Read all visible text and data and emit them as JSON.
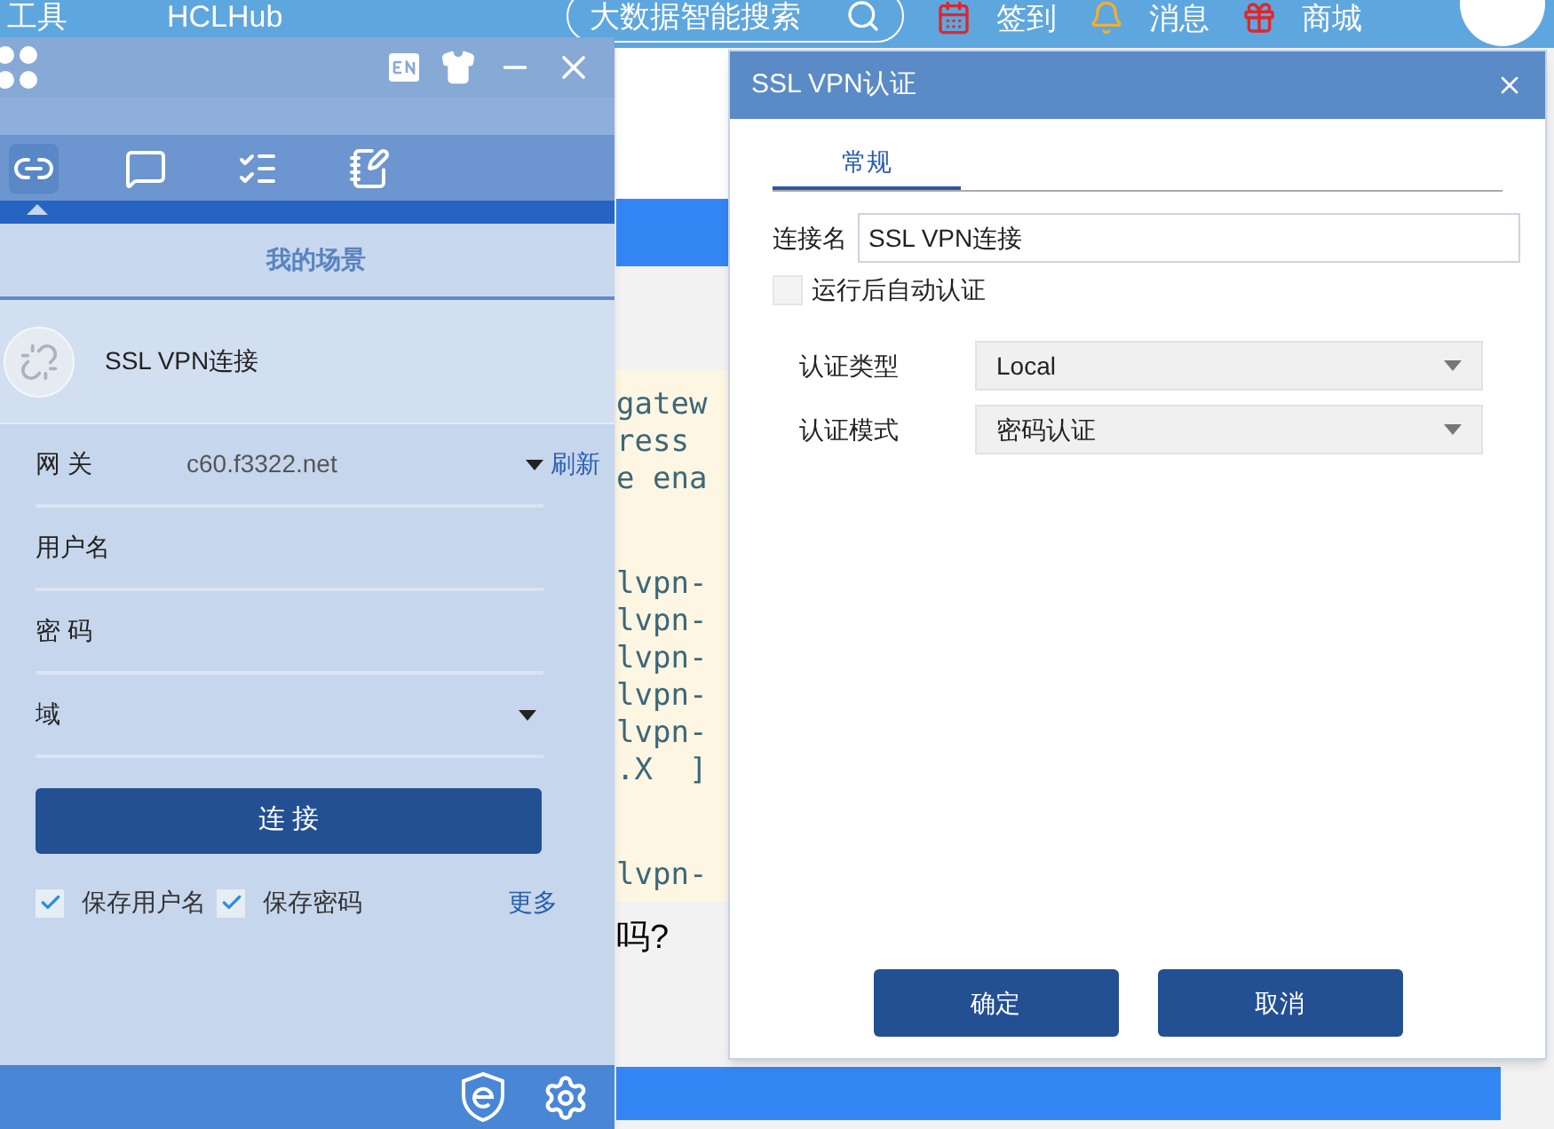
{
  "web_page": {
    "top_bar": {
      "items": [
        "工具",
        "HCLHub"
      ],
      "search_placeholder": "大数据智能搜索",
      "links": [
        {
          "kind": "calendar",
          "label": "签到"
        },
        {
          "kind": "bell",
          "label": "消息"
        },
        {
          "kind": "gift",
          "label": "商城"
        }
      ]
    },
    "code_blocks": [
      [
        "gatew",
        "ress",
        "e ena"
      ],
      [
        "lvpn-",
        "lvpn-",
        "lvpn-",
        "lvpn-",
        "lvpn-",
        ".X  ]"
      ],
      [
        "lvpn-"
      ]
    ],
    "text_fragment": "吗?"
  },
  "inode_client": {
    "tabs": [
      {
        "kind": "link",
        "selected": true
      },
      {
        "kind": "message",
        "selected": false
      },
      {
        "kind": "list",
        "selected": false
      },
      {
        "kind": "notebook",
        "selected": false
      }
    ],
    "section_title": "我的场景",
    "scene": "SSL VPN连接",
    "form": [
      {
        "kind": "select",
        "label": "网 关",
        "value": "c60.f3322.net",
        "action": "刷新"
      },
      {
        "kind": "text",
        "label": "用户名"
      },
      {
        "kind": "password",
        "label": "密 码"
      },
      {
        "kind": "select",
        "label": "域"
      }
    ],
    "connect_button": "连 接",
    "options": [
      {
        "label": "保存用户名",
        "checked": true
      },
      {
        "label": "保存密码",
        "checked": true
      }
    ],
    "more_link": "更多"
  },
  "dialog": {
    "title": "SSL VPN认证",
    "tabs": [
      {
        "label": "常规",
        "selected": true
      }
    ],
    "connection_name": {
      "label": "连接名",
      "value": "SSL VPN连接"
    },
    "auto_auth": {
      "label": "运行后自动认证",
      "checked": false
    },
    "selects": [
      {
        "label": "认证类型",
        "value": "Local"
      },
      {
        "label": "认证模式",
        "value": "密码认证"
      }
    ],
    "buttons": [
      "确定",
      "取消"
    ]
  }
}
